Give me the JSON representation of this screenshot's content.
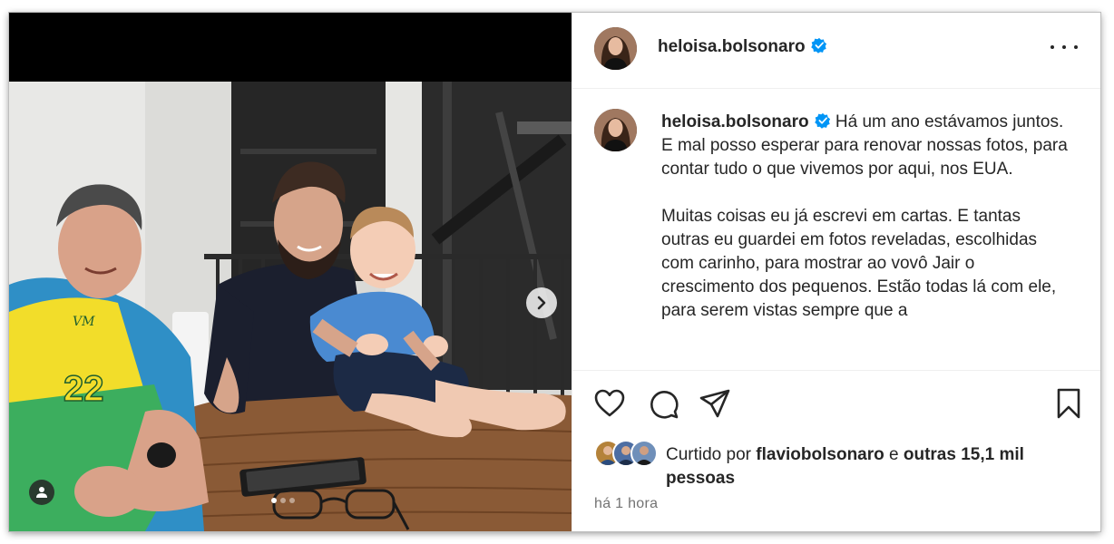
{
  "post": {
    "username": "heloisa.bolsonaro",
    "verified": true,
    "caption": {
      "username": "heloisa.bolsonaro",
      "text": " Há um ano estávamos juntos.\nE mal posso esperar para renovar nossas fotos, para contar tudo o que vivemos por aqui, nos EUA.\n\nMuitas coisas eu já escrevi em cartas. E tantas outras eu guardei em fotos reveladas, escolhidas com carinho, para mostrar ao vovô Jair o crescimento dos pequenos. Estão todas lá com ele, para serem vistas sempre que a"
    },
    "likes": {
      "prefix": "Curtido por ",
      "user": "flaviobolsonaro",
      "connector": " e ",
      "others": "outras 15,1 mil pessoas"
    },
    "time": "há 1 hora",
    "carousel": {
      "current": 1,
      "total": 3
    }
  },
  "icons": {
    "more": "more-options-icon",
    "like": "heart-icon",
    "comment": "comment-icon",
    "share": "share-icon",
    "save": "bookmark-icon",
    "next": "chevron-right-icon",
    "tag": "user-tag-icon",
    "verified": "verified-badge-icon"
  },
  "colors": {
    "text": "#262626",
    "secondary": "#737373",
    "verified": "#0095f6",
    "divider": "#efefef"
  }
}
